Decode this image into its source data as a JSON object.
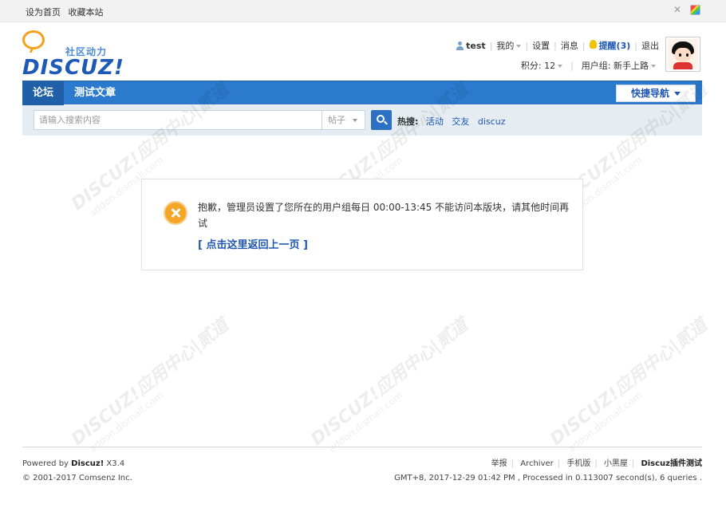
{
  "topbar": {
    "set_home": "设为首页",
    "bookmark": "收藏本站"
  },
  "logo": {
    "tagline": "社区动力",
    "wordmark": "DISCUZ!"
  },
  "userbar": {
    "username": "test",
    "my": "我的",
    "settings": "设置",
    "messages": "消息",
    "remind": "提醒(3)",
    "logout": "退出",
    "credits": "积分: 12",
    "usergroup": "用户组: 新手上路"
  },
  "nav": {
    "tabs": [
      {
        "label": "论坛"
      },
      {
        "label": "测试文章"
      }
    ],
    "quicknav": "快捷导航"
  },
  "search": {
    "placeholder": "请输入搜索内容",
    "type": "帖子",
    "hot_label": "热搜:",
    "hot_items": [
      "活动",
      "交友",
      "discuz"
    ]
  },
  "watermark": {
    "text": "DISCUZ!应用中心|贰道",
    "sub": "addon.dismall.com"
  },
  "message": {
    "text": "抱歉，管理员设置了您所在的用户组每日 00:00-13:45 不能访问本版块，请其他时间再试",
    "back_link": "[ 点击这里返回上一页 ]"
  },
  "footer": {
    "powered_prefix": "Powered by ",
    "powered_brand": "Discuz!",
    "powered_version": " X3.4",
    "copyright": "© 2001-2017 Comsenz Inc.",
    "links": [
      "举报",
      "Archiver",
      "手机版",
      "小黑屋"
    ],
    "site_name": "Discuz插件测试",
    "stats": "GMT+8, 2017-12-29 01:42 PM , Processed in 0.113007 second(s), 6 queries ."
  },
  "colors": {
    "accent": "#2b7acd",
    "link": "#1f57b3",
    "warning": "#f5a626"
  }
}
